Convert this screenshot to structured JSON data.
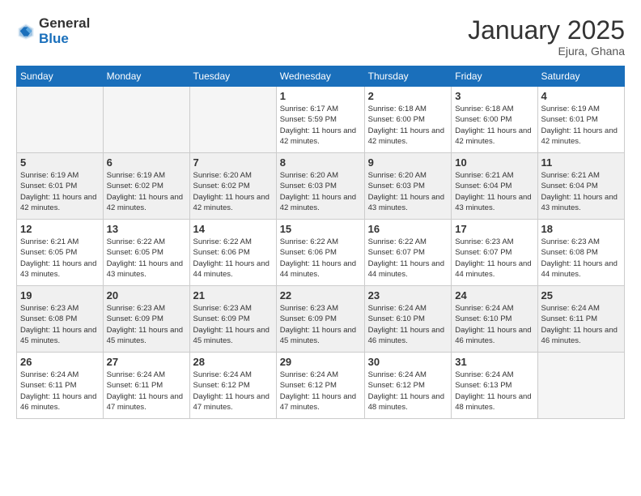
{
  "logo": {
    "general": "General",
    "blue": "Blue"
  },
  "title": "January 2025",
  "location": "Ejura, Ghana",
  "days_of_week": [
    "Sunday",
    "Monday",
    "Tuesday",
    "Wednesday",
    "Thursday",
    "Friday",
    "Saturday"
  ],
  "weeks": [
    [
      {
        "day": "",
        "info": ""
      },
      {
        "day": "",
        "info": ""
      },
      {
        "day": "",
        "info": ""
      },
      {
        "day": "1",
        "info": "Sunrise: 6:17 AM\nSunset: 5:59 PM\nDaylight: 11 hours and 42 minutes."
      },
      {
        "day": "2",
        "info": "Sunrise: 6:18 AM\nSunset: 6:00 PM\nDaylight: 11 hours and 42 minutes."
      },
      {
        "day": "3",
        "info": "Sunrise: 6:18 AM\nSunset: 6:00 PM\nDaylight: 11 hours and 42 minutes."
      },
      {
        "day": "4",
        "info": "Sunrise: 6:19 AM\nSunset: 6:01 PM\nDaylight: 11 hours and 42 minutes."
      }
    ],
    [
      {
        "day": "5",
        "info": "Sunrise: 6:19 AM\nSunset: 6:01 PM\nDaylight: 11 hours and 42 minutes."
      },
      {
        "day": "6",
        "info": "Sunrise: 6:19 AM\nSunset: 6:02 PM\nDaylight: 11 hours and 42 minutes."
      },
      {
        "day": "7",
        "info": "Sunrise: 6:20 AM\nSunset: 6:02 PM\nDaylight: 11 hours and 42 minutes."
      },
      {
        "day": "8",
        "info": "Sunrise: 6:20 AM\nSunset: 6:03 PM\nDaylight: 11 hours and 42 minutes."
      },
      {
        "day": "9",
        "info": "Sunrise: 6:20 AM\nSunset: 6:03 PM\nDaylight: 11 hours and 43 minutes."
      },
      {
        "day": "10",
        "info": "Sunrise: 6:21 AM\nSunset: 6:04 PM\nDaylight: 11 hours and 43 minutes."
      },
      {
        "day": "11",
        "info": "Sunrise: 6:21 AM\nSunset: 6:04 PM\nDaylight: 11 hours and 43 minutes."
      }
    ],
    [
      {
        "day": "12",
        "info": "Sunrise: 6:21 AM\nSunset: 6:05 PM\nDaylight: 11 hours and 43 minutes."
      },
      {
        "day": "13",
        "info": "Sunrise: 6:22 AM\nSunset: 6:05 PM\nDaylight: 11 hours and 43 minutes."
      },
      {
        "day": "14",
        "info": "Sunrise: 6:22 AM\nSunset: 6:06 PM\nDaylight: 11 hours and 44 minutes."
      },
      {
        "day": "15",
        "info": "Sunrise: 6:22 AM\nSunset: 6:06 PM\nDaylight: 11 hours and 44 minutes."
      },
      {
        "day": "16",
        "info": "Sunrise: 6:22 AM\nSunset: 6:07 PM\nDaylight: 11 hours and 44 minutes."
      },
      {
        "day": "17",
        "info": "Sunrise: 6:23 AM\nSunset: 6:07 PM\nDaylight: 11 hours and 44 minutes."
      },
      {
        "day": "18",
        "info": "Sunrise: 6:23 AM\nSunset: 6:08 PM\nDaylight: 11 hours and 44 minutes."
      }
    ],
    [
      {
        "day": "19",
        "info": "Sunrise: 6:23 AM\nSunset: 6:08 PM\nDaylight: 11 hours and 45 minutes."
      },
      {
        "day": "20",
        "info": "Sunrise: 6:23 AM\nSunset: 6:09 PM\nDaylight: 11 hours and 45 minutes."
      },
      {
        "day": "21",
        "info": "Sunrise: 6:23 AM\nSunset: 6:09 PM\nDaylight: 11 hours and 45 minutes."
      },
      {
        "day": "22",
        "info": "Sunrise: 6:23 AM\nSunset: 6:09 PM\nDaylight: 11 hours and 45 minutes."
      },
      {
        "day": "23",
        "info": "Sunrise: 6:24 AM\nSunset: 6:10 PM\nDaylight: 11 hours and 46 minutes."
      },
      {
        "day": "24",
        "info": "Sunrise: 6:24 AM\nSunset: 6:10 PM\nDaylight: 11 hours and 46 minutes."
      },
      {
        "day": "25",
        "info": "Sunrise: 6:24 AM\nSunset: 6:11 PM\nDaylight: 11 hours and 46 minutes."
      }
    ],
    [
      {
        "day": "26",
        "info": "Sunrise: 6:24 AM\nSunset: 6:11 PM\nDaylight: 11 hours and 46 minutes."
      },
      {
        "day": "27",
        "info": "Sunrise: 6:24 AM\nSunset: 6:11 PM\nDaylight: 11 hours and 47 minutes."
      },
      {
        "day": "28",
        "info": "Sunrise: 6:24 AM\nSunset: 6:12 PM\nDaylight: 11 hours and 47 minutes."
      },
      {
        "day": "29",
        "info": "Sunrise: 6:24 AM\nSunset: 6:12 PM\nDaylight: 11 hours and 47 minutes."
      },
      {
        "day": "30",
        "info": "Sunrise: 6:24 AM\nSunset: 6:12 PM\nDaylight: 11 hours and 48 minutes."
      },
      {
        "day": "31",
        "info": "Sunrise: 6:24 AM\nSunset: 6:13 PM\nDaylight: 11 hours and 48 minutes."
      },
      {
        "day": "",
        "info": ""
      }
    ]
  ]
}
